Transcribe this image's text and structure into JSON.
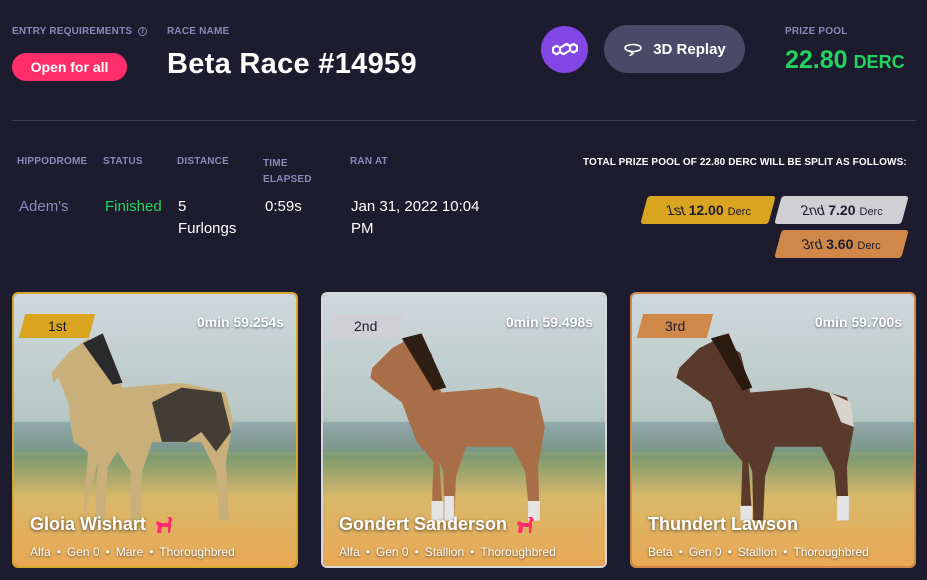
{
  "header": {
    "entry_label": "ENTRY REQUIREMENTS",
    "entry_value": "Open for all",
    "race_name_label": "RACE NAME",
    "race_name": "Beta Race #14959",
    "replay_label": "3D Replay",
    "prize_label": "PRIZE POOL",
    "prize_amount": "22.80",
    "prize_currency": "DERC"
  },
  "details": {
    "hippodrome_label": "HIPPODROME",
    "hippodrome": "Adem's",
    "status_label": "STATUS",
    "status": "Finished",
    "distance_label": "DISTANCE",
    "distance_line1": "5",
    "distance_line2": "Furlongs",
    "time_label_line1": "TIME",
    "time_label_line2": "ELAPSED",
    "time_elapsed": "0:59s",
    "ran_at_label": "RAN AT",
    "ran_at_line1": "Jan 31, 2022 10:04",
    "ran_at_line2": "PM"
  },
  "split": {
    "title": "TOTAL PRIZE POOL OF 22.80 DERC WILL BE SPLIT AS FOLLOWS:",
    "first": {
      "place": "1st",
      "amount": "12.00",
      "currency": "Derc"
    },
    "second": {
      "place": "2nd",
      "amount": "7.20",
      "currency": "Derc"
    },
    "third": {
      "place": "3rd",
      "amount": "3.60",
      "currency": "Derc"
    }
  },
  "results": [
    {
      "position": "1st",
      "time": "0min 59.254s",
      "name": "Gloia Wishart",
      "type": "Alfa",
      "gen": "Gen 0",
      "gender": "Mare",
      "breed": "Thoroughbred"
    },
    {
      "position": "2nd",
      "time": "0min 59.498s",
      "name": "Gondert Sanderson",
      "type": "Alfa",
      "gen": "Gen 0",
      "gender": "Stallion",
      "breed": "Thoroughbred"
    },
    {
      "position": "3rd",
      "time": "0min 59.700s",
      "name": "Thundert Lawson",
      "type": "Beta",
      "gen": "Gen 0",
      "gender": "Stallion",
      "breed": "Thoroughbred"
    }
  ],
  "icons": {
    "info": "info-icon",
    "polygon": "polygon-logo-icon",
    "replay": "replay-icon",
    "horse": "horse-icon"
  },
  "colors": {
    "background": "#1c1c2e",
    "open_badge": "#ff2d6a",
    "prize_green": "#22d35f",
    "polygon_purple": "#8247e5",
    "gold": "#d9a520",
    "silver": "#d0d0d4",
    "bronze": "#d08848",
    "horse_icon": "#ff2d6a"
  }
}
